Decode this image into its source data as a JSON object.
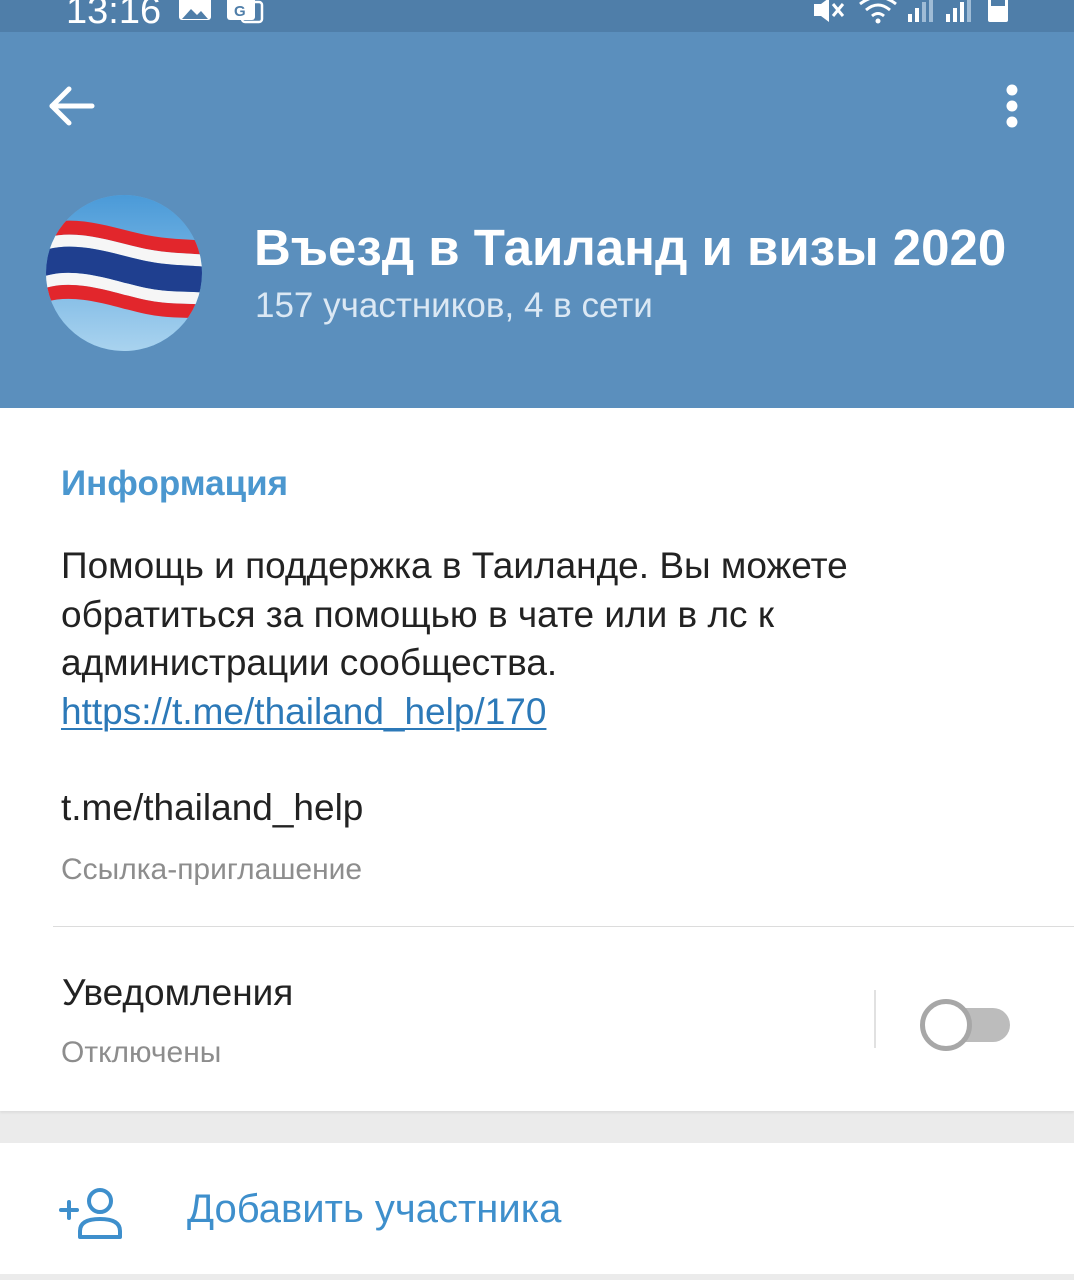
{
  "status_bar": {
    "time": "13:16",
    "icons": [
      "image-icon",
      "translate-icon",
      "mute-icon",
      "wifi-icon",
      "signal-icon",
      "signal-icon",
      "battery-icon"
    ]
  },
  "header": {
    "title": "Въезд в Таиланд и визы 2020",
    "subtitle": "157 участников, 4 в сети",
    "back_icon": "arrow-left-icon",
    "menu_icon": "more-vertical-icon",
    "colors": {
      "background": "#5b8fbd",
      "status_bar": "#4f7ea9"
    }
  },
  "info": {
    "section_title": "Информация",
    "description": "Помощь и поддержка в Таиланде. Вы можете обратиться за помощью в чате или в лс к администрации сообщества.",
    "description_link": "https://t.me/thailand_help/170",
    "invite_link": "t.me/thailand_help",
    "invite_caption": "Ссылка-приглашение",
    "accent_color": "#4b97cf"
  },
  "notifications": {
    "label": "Уведомления",
    "state": "Отключены",
    "enabled": false
  },
  "actions": {
    "add_member_label": "Добавить участника",
    "add_member_icon": "add-user-icon"
  }
}
